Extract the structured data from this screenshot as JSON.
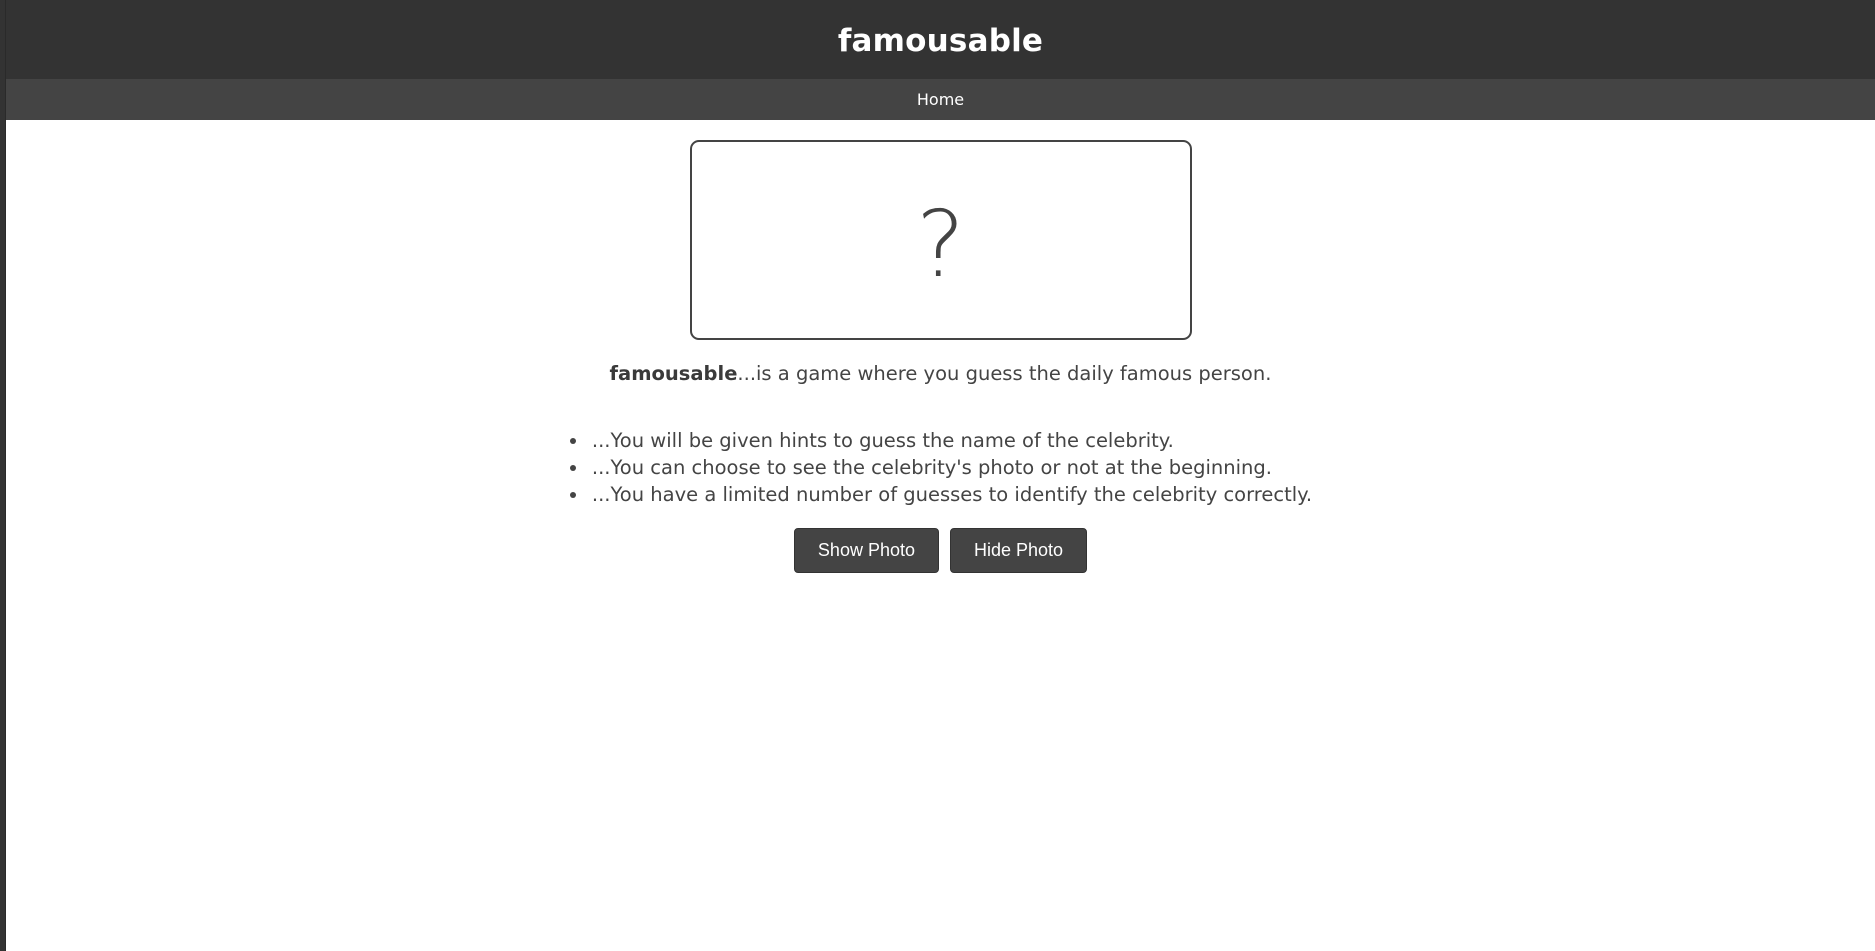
{
  "header": {
    "title": "famousable"
  },
  "nav": {
    "home_label": "Home"
  },
  "photo": {
    "placeholder_glyph": "?"
  },
  "intro": {
    "brand": "famousable",
    "text": "...is a game where you guess the daily famous person."
  },
  "rules": [
    "...You will be given hints to guess the name of the celebrity.",
    "...You can choose to see the celebrity's photo or not at the beginning.",
    "...You have a limited number of guesses to identify the celebrity correctly."
  ],
  "buttons": {
    "show_photo": "Show Photo",
    "hide_photo": "Hide Photo"
  },
  "colors": {
    "header_bg": "#333333",
    "nav_bg": "#444444",
    "button_bg": "#444444",
    "text": "#444444"
  }
}
